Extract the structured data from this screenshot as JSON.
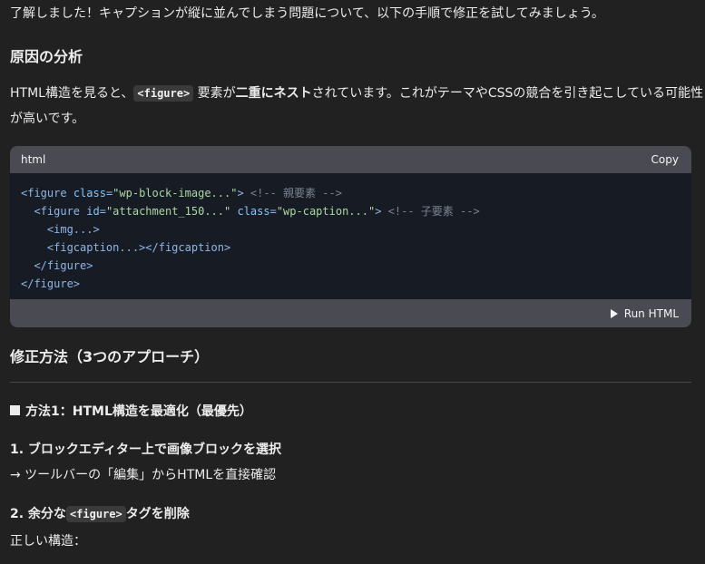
{
  "intro": "了解しました！キャプションが縦に並んでしまう問題について、以下の手順で修正を試してみましょう。",
  "section1_title": "原因の分析",
  "analysis": {
    "part1": "HTML構造を見ると、",
    "code": "<figure>",
    "part2": " 要素が",
    "bold": "二重にネスト",
    "part3": "されています。これがテーマやCSSの競合を引き起こしている可能性",
    "line2": "が高いです。"
  },
  "codeblock": {
    "language": "html",
    "copy_label": "Copy",
    "run_label": "Run HTML",
    "lines": [
      {
        "indent": "",
        "tag_open": "<figure",
        "attr": "class",
        "eq": "=",
        "value": "\"wp-block-image...\"",
        "tag_close": ">",
        "comment": " <!-- 親要素 -->"
      },
      {
        "indent": "  ",
        "tag_open": "<figure",
        "attr": "id",
        "eq": "=",
        "value": "\"attachment_150...\"",
        "attr2": "class",
        "value2": "\"wp-caption...\"",
        "tag_close": ">",
        "comment": " <!-- 子要素 -->"
      },
      {
        "indent": "    ",
        "text": "<img...>"
      },
      {
        "indent": "    ",
        "text": "<figcaption...></figcaption>"
      },
      {
        "indent": "  ",
        "text": "</figure>"
      },
      {
        "indent": "",
        "text": "</figure>"
      }
    ]
  },
  "section2_title": "修正方法（3つのアプローチ）",
  "method1_title": "方法1：HTML構造を最適化（最優先）",
  "step1_title": "1. ブロックエディター上で画像ブロックを選択",
  "step1_desc": "→ ツールバーの「編集」からHTMLを直接確認",
  "step2": {
    "prefix": "2. 余分な",
    "code": "<figure>",
    "suffix": "タグを削除"
  },
  "correct_structure": "正しい構造："
}
